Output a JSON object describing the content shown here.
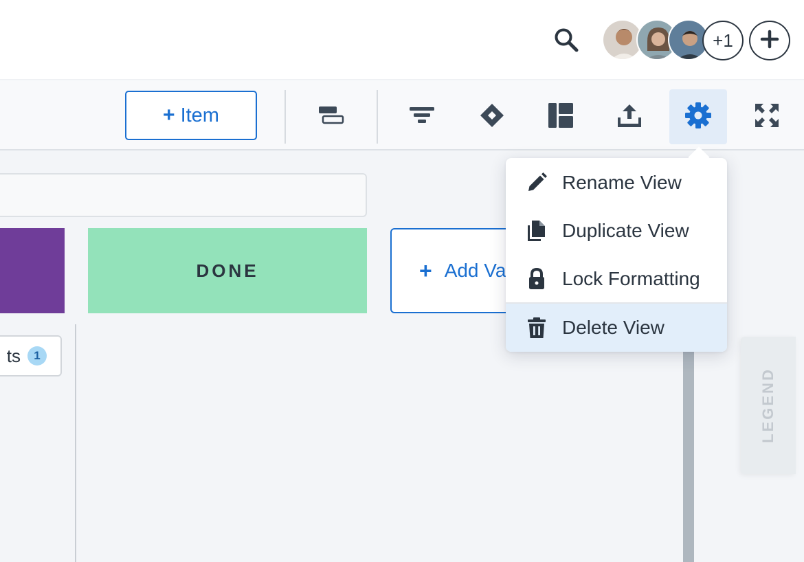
{
  "header": {
    "more_members": "+1"
  },
  "toolbar": {
    "item_button_label": "Item",
    "item_button_plus": "+"
  },
  "board": {
    "lane_done_label": "DONE",
    "add_value_plus": "+",
    "add_value_label": "Add Va",
    "chip_text": "ts",
    "chip_count": "1",
    "legend_label": "LEGEND",
    "lane_colors": {
      "purple": "#6f3d99",
      "done": "#93e2ba"
    }
  },
  "menu": {
    "items": [
      {
        "label": "Rename View",
        "icon": "pencil-icon"
      },
      {
        "label": "Duplicate View",
        "icon": "copy-icon"
      },
      {
        "label": "Lock Formatting",
        "icon": "lock-icon"
      },
      {
        "label": "Delete View",
        "icon": "trash-icon",
        "highlighted": true
      }
    ]
  },
  "theme": {
    "accent": "#1a6fd1",
    "icon_dark": "#3c4957"
  }
}
